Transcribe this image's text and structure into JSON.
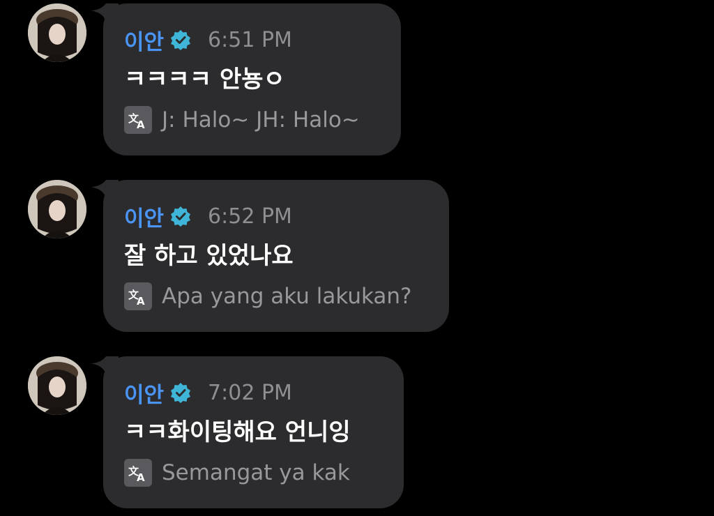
{
  "colors": {
    "background": "#000000",
    "bubble": "#2c2c2e",
    "username": "#4a94f4",
    "verified_badge": "#3fb6d8",
    "timestamp": "#8e8e93",
    "message_text": "#ffffff",
    "translation_text": "#98989d",
    "translate_icon_bg": "#5a5a5e"
  },
  "messages": [
    {
      "username": "이안",
      "verified_icon": "verified-badge-icon",
      "timestamp": "6:51 PM",
      "text": "ㅋㅋㅋㅋ 안뇽ㅇ",
      "translation_icon": "translate-icon",
      "translation": "J: Halo~ JH: Halo~"
    },
    {
      "username": "이안",
      "verified_icon": "verified-badge-icon",
      "timestamp": "6:52 PM",
      "text": "잘 하고 있었나요",
      "translation_icon": "translate-icon",
      "translation": "Apa yang aku lakukan?"
    },
    {
      "username": "이안",
      "verified_icon": "verified-badge-icon",
      "timestamp": "7:02 PM",
      "text": "ㅋㅋ화이팅해요 언니잉",
      "translation_icon": "translate-icon",
      "translation": "Semangat ya kak"
    }
  ]
}
